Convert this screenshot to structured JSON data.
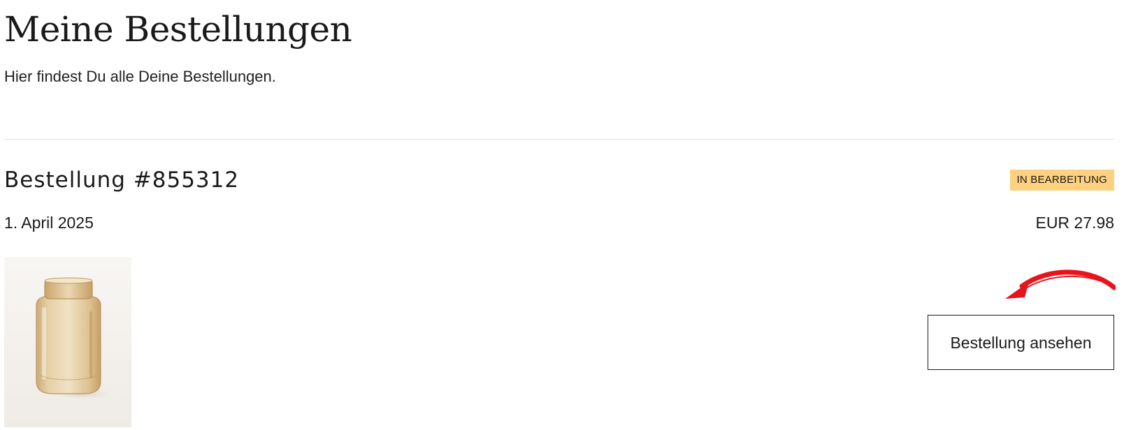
{
  "header": {
    "title": "Meine Bestellungen",
    "subtitle": "Hier findest Du alle Deine Bestellungen."
  },
  "order": {
    "number_label": "Bestellung #855312",
    "status": "IN BEARBEITUNG",
    "date": "1. April 2025",
    "total": "EUR 27.98",
    "view_button_label": "Bestellung ansehen",
    "product_image_icon": "glass-vase-image"
  },
  "colors": {
    "status_badge_bg": "#fdd17f",
    "annotation_arrow": "#e8141c",
    "divider": "#e3e3e3",
    "text": "#1a1a1a"
  }
}
